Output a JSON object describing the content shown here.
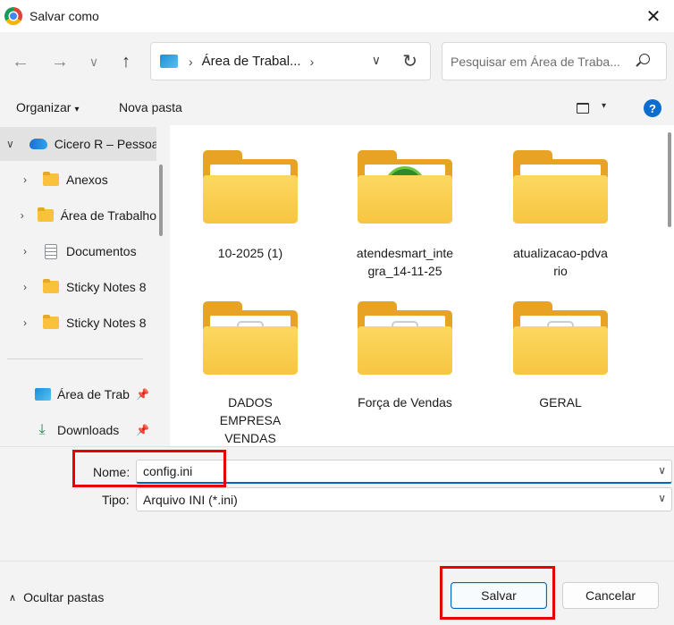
{
  "window": {
    "title": "Salvar como",
    "close_glyph": "✕"
  },
  "nav": {
    "back_glyph": "←",
    "forward_glyph": "→",
    "recent_glyph": "∨",
    "up_glyph": "↑"
  },
  "address": {
    "sep": "›",
    "path": "Área de Trabal...",
    "sep2": "›",
    "down": "∨",
    "refresh": "↻"
  },
  "search": {
    "placeholder": "Pesquisar em Área de Traba..."
  },
  "toolbar": {
    "organize": "Organizar",
    "organize_caret": "▾",
    "new_folder": "Nova pasta",
    "view_caret": "▾",
    "help": "?"
  },
  "sidebar": {
    "items": [
      {
        "label": "Cicero R – Pessoal",
        "arrow": "∨",
        "icon": "onedrive-icon"
      },
      {
        "label": "Anexos",
        "arrow": "›",
        "icon": "folder-icon"
      },
      {
        "label": "Área de Trabalho",
        "arrow": "›",
        "icon": "folder-icon"
      },
      {
        "label": "Documentos",
        "arrow": "›",
        "icon": "document-icon"
      },
      {
        "label": "Sticky Notes 8",
        "arrow": "›",
        "icon": "folder-icon"
      },
      {
        "label": "Sticky Notes 8",
        "arrow": "›",
        "icon": "folder-icon"
      }
    ],
    "quick": [
      {
        "label": "Área de Trab",
        "icon": "desktop-icon",
        "pin": "📌"
      },
      {
        "label": "Downloads",
        "icon": "download-icon",
        "pin": "📌"
      }
    ]
  },
  "files": [
    {
      "name": "10-2025 (1)",
      "type": "plain"
    },
    {
      "name": "atendesmart_integra_14-11-25",
      "line1": "atendesmart_inte",
      "line2": "gra_14-11-25",
      "type": "badge",
      "badge": "HS"
    },
    {
      "name": "atualizacao-pdvario",
      "line1": "atualizacao-pdva",
      "line2": "rio",
      "type": "plain"
    },
    {
      "name": "DADOS EMPRESA VENDAS",
      "line1": "DADOS",
      "line2": "EMPRESA",
      "line3": "VENDAS",
      "type": "doc"
    },
    {
      "name": "Força de Vendas",
      "type": "doc"
    },
    {
      "name": "GERAL",
      "type": "doc"
    }
  ],
  "form": {
    "name_label": "Nome:",
    "name_value": "config.ini",
    "type_label": "Tipo:",
    "type_value": "Arquivo INI (*.ini)",
    "chev": "∨"
  },
  "footer": {
    "hide_folders": "Ocultar pastas",
    "hide_caret": "∧",
    "save": "Salvar",
    "cancel": "Cancelar"
  },
  "colors": {
    "accent": "#0067c0",
    "highlight_red": "#e60000",
    "folder": "#f7c542"
  }
}
